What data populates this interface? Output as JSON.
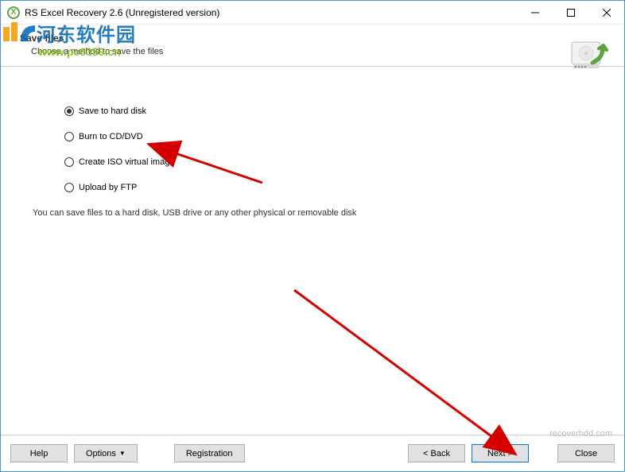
{
  "titlebar": {
    "title": "RS Excel Recovery 2.6 (Unregistered version)"
  },
  "header": {
    "title": "Save files",
    "subtitle": "Choose a method to save the files"
  },
  "radios": [
    {
      "label": "Save to hard disk",
      "checked": true
    },
    {
      "label": "Burn to CD/DVD",
      "checked": false
    },
    {
      "label": "Create ISO virtual image",
      "checked": false
    },
    {
      "label": "Upload by FTP",
      "checked": false
    }
  ],
  "hint": "You can save files to a hard disk, USB drive or any other physical or removable disk",
  "footer_link": "recoverhdd.com",
  "buttons": {
    "help": "Help",
    "options": "Options",
    "registration": "Registration",
    "back": "< Back",
    "next": "Next >",
    "close": "Close"
  },
  "watermark": {
    "cn": "河东软件园",
    "url": "www.pc0359.cn"
  }
}
